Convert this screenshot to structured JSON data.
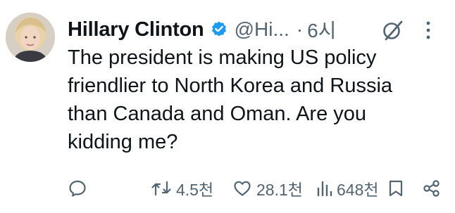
{
  "author": {
    "name": "Hillary Clinton",
    "handle": "@Hi...",
    "time": "6시",
    "verified": true,
    "verified_color": "#1d9bf0"
  },
  "header": {
    "separator": "·",
    "icons": [
      "grok-icon",
      "more-icon"
    ]
  },
  "tweet": {
    "text": "The president is making US policy\nfriendlier to North Korea and Russia\nthan Canada and Oman. Are you\nkidding me?"
  },
  "actions": {
    "reply": {
      "icon": "reply-icon",
      "count": ""
    },
    "retweet": {
      "icon": "retweet-icon",
      "count": "4.5천"
    },
    "like": {
      "icon": "heart-icon",
      "count": "28.1천"
    },
    "views": {
      "icon": "views-icon",
      "count": "648천"
    },
    "bookmark": {
      "icon": "bookmark-icon"
    },
    "share": {
      "icon": "share-icon"
    }
  },
  "colors": {
    "text": "#0f1419",
    "muted": "#536471",
    "verified": "#1d9bf0"
  }
}
